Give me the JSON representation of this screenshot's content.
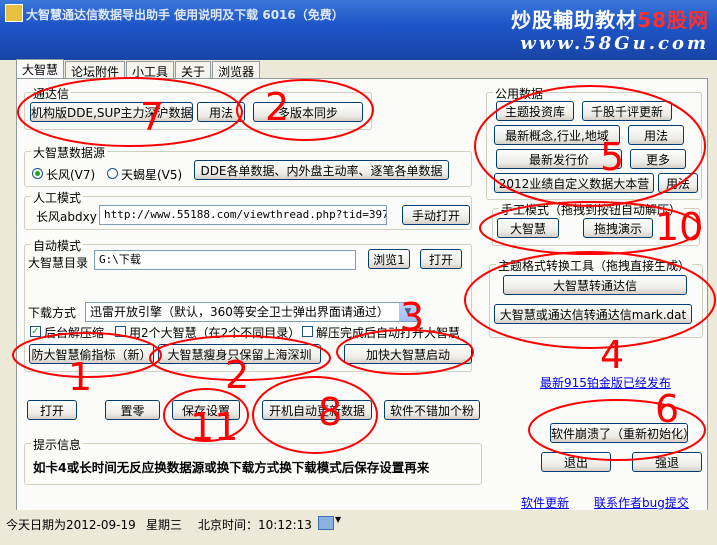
{
  "window": {
    "title": "大智慧通达信数据导出助手 使用说明及下载 6016（免费）"
  },
  "watermark": {
    "line1": "炒股輔助教材",
    "line2": "58股网",
    "url": "www.58Gu.com"
  },
  "tabs": [
    "大智慧",
    "论坛附件",
    "小工具",
    "关于",
    "浏览器"
  ],
  "tdx": {
    "legend": "通达信",
    "btn_main": "机构版DDE,SUP主力深沪数据",
    "btn_usage": "用法",
    "btn_sync": "多版本同步"
  },
  "dzh_source": {
    "legend": "大智慧数据源",
    "radio1": "长风(V7)",
    "radio2": "天蝎星(V5)",
    "btn_dde": "DDE各单数据、内外盘主动率、逐笔各单数据"
  },
  "manual": {
    "legend": "人工模式",
    "label": "长风abdxy",
    "url_value": "http://www.55188.com/viewthread.php?tid=3977509",
    "btn_open": "手动打开"
  },
  "auto": {
    "legend": "自动模式",
    "dir_label": "大智慧目录",
    "dir_value": "G:\\下载",
    "btn_browse": "浏览1",
    "btn_open": "打开",
    "download_label": "下载方式",
    "download_value": "迅雷开放引擎（默认，360等安全卫士弹出界面请通过）",
    "chk1": "后台解压缩",
    "chk2": "用2个大智慧（在2个不同目录）",
    "chk3": "解压完成后自动打开大智慧",
    "btn_anti": "防大智慧偷指标（新）",
    "btn_slim": "大智慧瘦身只保留上海深圳",
    "btn_speed": "加快大智慧启动"
  },
  "bottom_buttons": {
    "open": "打开",
    "reset": "置零",
    "save": "保存设置",
    "autostart": "开机自动更新数据",
    "addfan": "软件不错加个粉"
  },
  "info": {
    "legend": "提示信息",
    "text": "如卡4或长时间无反应换数据源或换下载方式换下载模式后保存设置再来"
  },
  "common": {
    "legend": "公用数据",
    "btn_topic": "主题投资库",
    "btn_qianping": "千股千评更新",
    "btn_newconcept": "最新概念,行业,地域",
    "btn_usage1": "用法",
    "btn_newprice": "最新发行价",
    "btn_more": "更多",
    "btn_2012": "2012业绩自定义数据大本营",
    "btn_usage2": "用法"
  },
  "manual_mode": {
    "legend": "手工模式（拖拽到按钮自动解压）",
    "btn_dzh": "大智慧",
    "btn_drag": "拖拽演示"
  },
  "convert": {
    "legend": "主题格式转换工具（拖拽直接生成）",
    "btn_to_tdx": "大智慧转通达信",
    "btn_mark": "大智慧或通达信转通达信mark.dat"
  },
  "link_latest": "最新915铂金版已经发布",
  "btn_crash": "软件崩溃了（重新初始化）",
  "btn_exit": "退出",
  "btn_force_exit": "强退",
  "link_update": "软件更新",
  "link_contact": "联系作者bug提交",
  "status": {
    "date": "今天日期为2012-09-19",
    "weekday": "星期三",
    "time": "北京时间：10:12:13"
  },
  "annotations": [
    "1",
    "2",
    "3",
    "4",
    "5",
    "6",
    "7",
    "8",
    "9",
    "10",
    "11",
    "12"
  ],
  "colors": {
    "title_bar": "#1e56c8",
    "annotation": "#ff0000",
    "link": "#0000ee",
    "panel": "#fbfbf9"
  }
}
